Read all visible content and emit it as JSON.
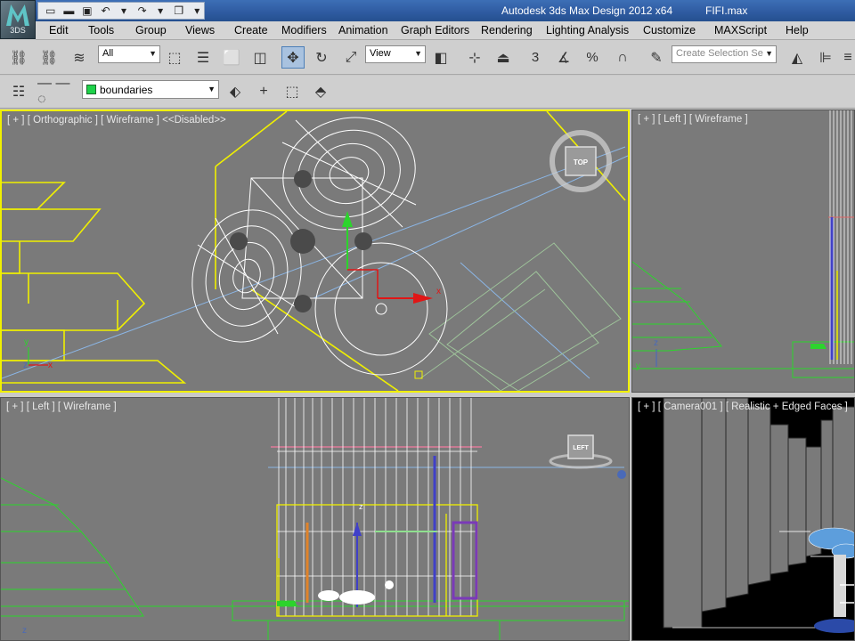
{
  "app": {
    "logo_text": "3DS",
    "title": "Autodesk 3ds Max Design 2012 x64",
    "file": "FIFI.max"
  },
  "menu": [
    "Edit",
    "Tools",
    "Group",
    "Views",
    "Create",
    "Modifiers",
    "Animation",
    "Graph Editors",
    "Rendering",
    "Lighting Analysis",
    "Customize",
    "MAXScript",
    "Help"
  ],
  "toolbar": {
    "filter_value": "All",
    "ref_coord_value": "View",
    "snap_value": "3",
    "angle_value": "%",
    "selection_set_placeholder": "Create Selection Se"
  },
  "layer": {
    "current": "boundaries",
    "color": "#1ed24a"
  },
  "viewports": {
    "ortho_label": "[ + ] [ Orthographic ] [ Wireframe ] <<Disabled>>",
    "left_small_label": "[ + ] [ Left ] [ Wireframe ]",
    "left_big_label": "[ + ] [ Left ] [ Wireframe ]",
    "camera_label": "[ + ] [ Camera001 ] [ Realistic + Edged Faces ]",
    "viewcube_top": "TOP",
    "viewcube_left": "LEFT",
    "axis_x": "x",
    "axis_y": "y",
    "axis_z": "z"
  },
  "colors": {
    "active_border": "#f0f000",
    "wire_white": "#ffffff",
    "wire_yellow": "#f0f000",
    "wire_green": "#2bd62b",
    "wire_blue": "#8bb6e6"
  }
}
